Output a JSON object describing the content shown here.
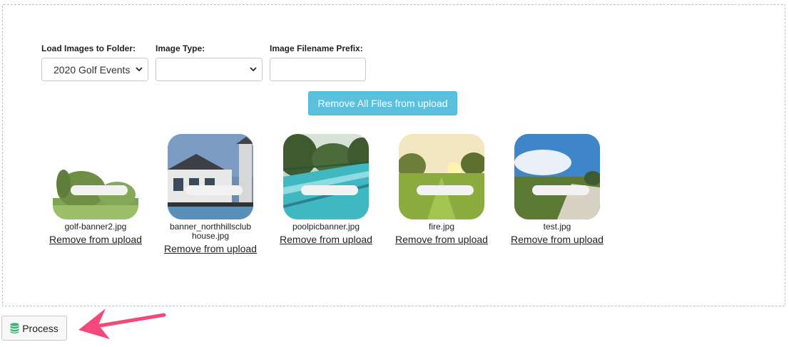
{
  "form": {
    "folder_label": "Load Images to Folder:",
    "folder_value": "2020 Golf Events",
    "type_label": "Image Type:",
    "type_value": "",
    "prefix_label": "Image Filename Prefix:",
    "prefix_value": ""
  },
  "remove_all_label": "Remove All Files from upload",
  "files": [
    {
      "name": "golf-banner2.jpg",
      "remove": "Remove from upload"
    },
    {
      "name": "banner_northhillsclub house.jpg",
      "remove": "Remove from upload"
    },
    {
      "name": "poolpicbanner.jpg",
      "remove": "Remove from upload"
    },
    {
      "name": "fire.jpg",
      "remove": "Remove from upload"
    },
    {
      "name": "test.jpg",
      "remove": "Remove from upload"
    }
  ],
  "process_label": "Process",
  "icons": {
    "process": "database-icon",
    "select": "chevron-down-icon",
    "annotation": "arrow-icon"
  },
  "colors": {
    "accent": "#5bc0de",
    "arrow": "#f2497a",
    "process_icon": "#3cb371"
  }
}
